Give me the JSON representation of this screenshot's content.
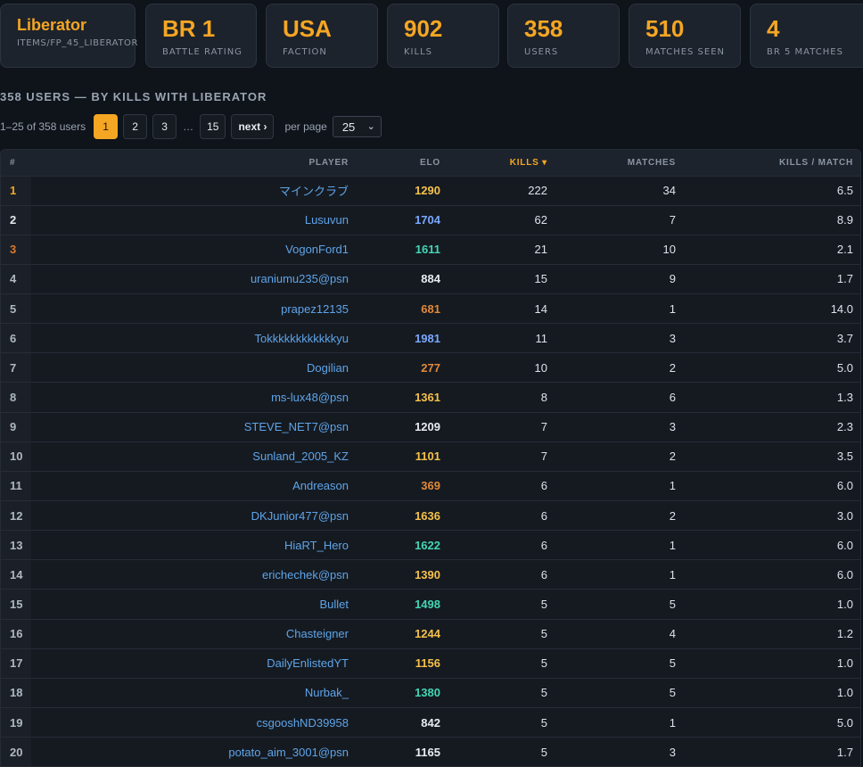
{
  "stats": [
    {
      "value": "Liberator",
      "label": "ITEMS/FP_45_LIBERATOR",
      "name": "weapon-name-card"
    },
    {
      "value": "BR 1",
      "label": "BATTLE RATING",
      "name": "battle-rating-card"
    },
    {
      "value": "USA",
      "label": "FACTION",
      "name": "faction-card"
    },
    {
      "value": "902",
      "label": "KILLS",
      "name": "kills-card"
    },
    {
      "value": "358",
      "label": "USERS",
      "name": "users-card"
    },
    {
      "value": "510",
      "label": "MATCHES SEEN",
      "name": "matches-seen-card"
    },
    {
      "value": "4",
      "label": "BR 5 MATCHES",
      "name": "br5-matches-card"
    }
  ],
  "section_title": "358 USERS — BY KILLS WITH LIBERATOR",
  "pagination": {
    "range_text": "1–25 of 358 users",
    "pages": [
      "1",
      "2",
      "3"
    ],
    "ellipsis": "…",
    "last_page": "15",
    "next_label": "next ›",
    "per_page_label": "per page",
    "per_page_value": "25",
    "caret": "⌄"
  },
  "table": {
    "columns": {
      "rank": "#",
      "player": "PLAYER",
      "elo": "ELO",
      "kills": "KILLS ▾",
      "matches": "MATCHES",
      "kpm": "KILLS / MATCH"
    },
    "rows": [
      {
        "rank": "1",
        "player": "マインクラブ",
        "elo": "1290",
        "tier": "gold",
        "kills": "222",
        "matches": "34",
        "kpm": "6.5"
      },
      {
        "rank": "2",
        "player": "Lusuvun",
        "elo": "1704",
        "tier": "blue",
        "kills": "62",
        "matches": "7",
        "kpm": "8.9"
      },
      {
        "rank": "3",
        "player": "VogonFord1",
        "elo": "1611",
        "tier": "teal",
        "kills": "21",
        "matches": "10",
        "kpm": "2.1"
      },
      {
        "rank": "4",
        "player": "uraniumu235@psn",
        "elo": "884",
        "tier": "white",
        "kills": "15",
        "matches": "9",
        "kpm": "1.7"
      },
      {
        "rank": "5",
        "player": "prapez12135",
        "elo": "681",
        "tier": "orange",
        "kills": "14",
        "matches": "1",
        "kpm": "14.0"
      },
      {
        "rank": "6",
        "player": "Tokkkkkkkkkkkkyu",
        "elo": "1981",
        "tier": "blue",
        "kills": "11",
        "matches": "3",
        "kpm": "3.7"
      },
      {
        "rank": "7",
        "player": "Dogilian",
        "elo": "277",
        "tier": "orange",
        "kills": "10",
        "matches": "2",
        "kpm": "5.0"
      },
      {
        "rank": "8",
        "player": "ms-lux48@psn",
        "elo": "1361",
        "tier": "gold",
        "kills": "8",
        "matches": "6",
        "kpm": "1.3"
      },
      {
        "rank": "9",
        "player": "STEVE_NET7@psn",
        "elo": "1209",
        "tier": "white",
        "kills": "7",
        "matches": "3",
        "kpm": "2.3"
      },
      {
        "rank": "10",
        "player": "Sunland_2005_KZ",
        "elo": "1101",
        "tier": "gold",
        "kills": "7",
        "matches": "2",
        "kpm": "3.5"
      },
      {
        "rank": "11",
        "player": "Andreason",
        "elo": "369",
        "tier": "orange",
        "kills": "6",
        "matches": "1",
        "kpm": "6.0"
      },
      {
        "rank": "12",
        "player": "DKJunior477@psn",
        "elo": "1636",
        "tier": "gold",
        "kills": "6",
        "matches": "2",
        "kpm": "3.0"
      },
      {
        "rank": "13",
        "player": "HiaRT_Hero",
        "elo": "1622",
        "tier": "teal",
        "kills": "6",
        "matches": "1",
        "kpm": "6.0"
      },
      {
        "rank": "14",
        "player": "erichechek@psn",
        "elo": "1390",
        "tier": "gold",
        "kills": "6",
        "matches": "1",
        "kpm": "6.0"
      },
      {
        "rank": "15",
        "player": "Bullet",
        "elo": "1498",
        "tier": "teal",
        "kills": "5",
        "matches": "5",
        "kpm": "1.0"
      },
      {
        "rank": "16",
        "player": "Chasteigner",
        "elo": "1244",
        "tier": "gold",
        "kills": "5",
        "matches": "4",
        "kpm": "1.2"
      },
      {
        "rank": "17",
        "player": "DailyEnlistedYT",
        "elo": "1156",
        "tier": "gold",
        "kills": "5",
        "matches": "5",
        "kpm": "1.0"
      },
      {
        "rank": "18",
        "player": "Nurbak_",
        "elo": "1380",
        "tier": "teal",
        "kills": "5",
        "matches": "5",
        "kpm": "1.0"
      },
      {
        "rank": "19",
        "player": "csgooshND39958",
        "elo": "842",
        "tier": "white",
        "kills": "5",
        "matches": "1",
        "kpm": "5.0"
      },
      {
        "rank": "20",
        "player": "potato_aim_3001@psn",
        "elo": "1165",
        "tier": "white",
        "kills": "5",
        "matches": "3",
        "kpm": "1.7"
      }
    ]
  },
  "colors": {
    "accent": "#f5a623",
    "link": "#5ea4e8",
    "background": "#0f131a"
  }
}
